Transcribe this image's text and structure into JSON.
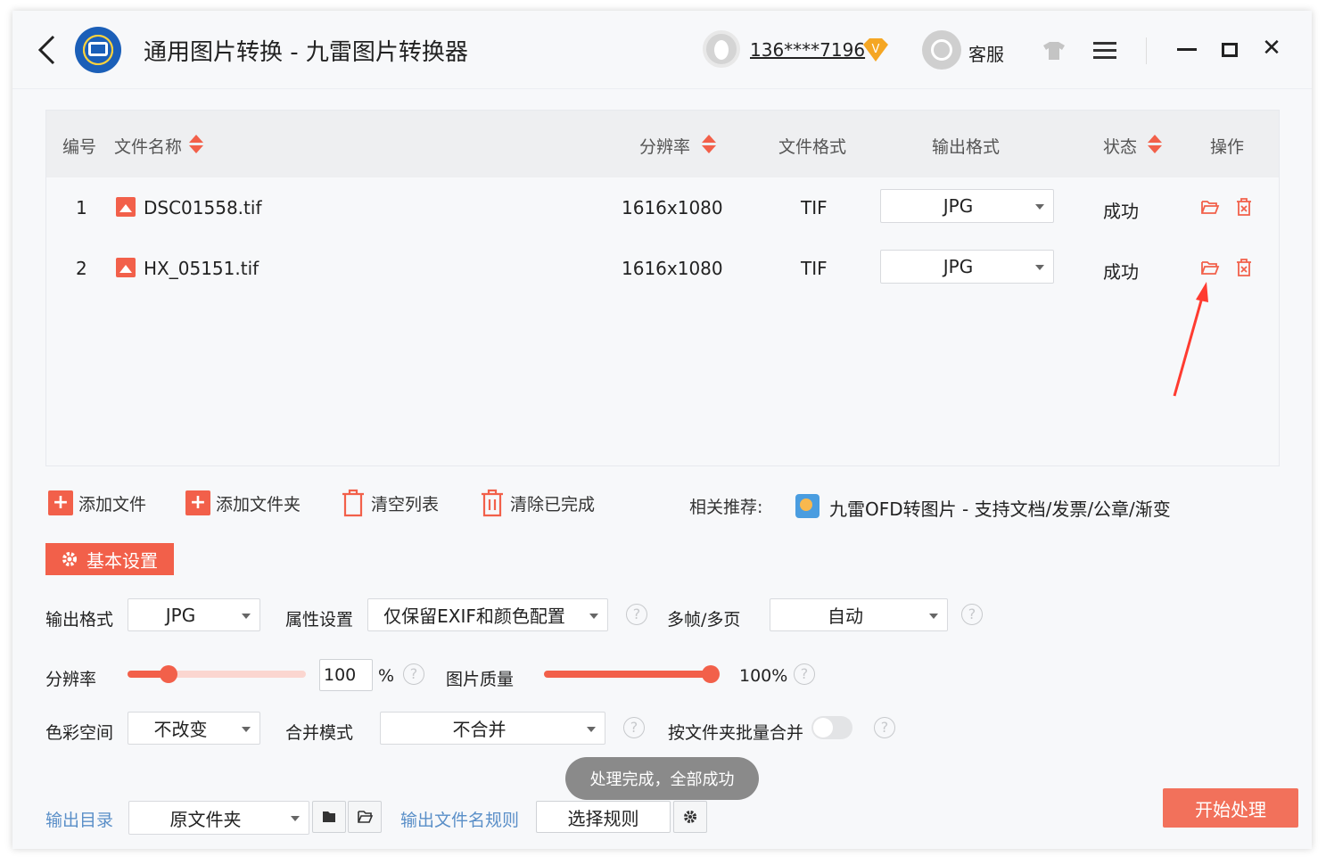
{
  "window": {
    "title": "通用图片转换 - 九雷图片转换器",
    "user_name": "136****7196",
    "vip_badge": "V",
    "service_label": "客服",
    "close_glyph": "✕"
  },
  "table": {
    "headers": {
      "index": "编号",
      "filename": "文件名称",
      "resolution": "分辨率",
      "file_format": "文件格式",
      "output_format": "输出格式",
      "status": "状态",
      "actions": "操作"
    },
    "rows": [
      {
        "index": "1",
        "filename": "DSC01558.tif",
        "resolution": "1616x1080",
        "file_format": "TIF",
        "output_format": "JPG",
        "status": "成功"
      },
      {
        "index": "2",
        "filename": "HX_05151.tif",
        "resolution": "1616x1080",
        "file_format": "TIF",
        "output_format": "JPG",
        "status": "成功"
      }
    ]
  },
  "toolbar": {
    "add_file": "添加文件",
    "add_folder": "添加文件夹",
    "clear_list": "清空列表",
    "clear_done": "清除已完成",
    "recommend_label": "相关推荐:",
    "recommend_link": "九雷OFD转图片 - 支持文档/发票/公章/渐变"
  },
  "settings": {
    "tab_label": "基本设置",
    "output_format_label": "输出格式",
    "output_format_value": "JPG",
    "attr_label": "属性设置",
    "attr_value": "仅保留EXIF和颜色配置",
    "multiframe_label": "多帧/多页",
    "multiframe_value": "自动",
    "resolution_label": "分辨率",
    "resolution_value": "100",
    "resolution_unit": "%",
    "quality_label": "图片质量",
    "quality_value": "100%",
    "colorspace_label": "色彩空间",
    "colorspace_value": "不改变",
    "merge_label": "合并模式",
    "merge_value": "不合并",
    "batch_merge_label": "按文件夹批量合并",
    "help_glyph": "?"
  },
  "output": {
    "dir_label": "输出目录",
    "dir_value": "原文件夹",
    "rule_label": "输出文件名规则",
    "rule_button": "选择规则",
    "start_button": "开始处理"
  },
  "toast": "处理完成，全部成功",
  "colors": {
    "accent": "#f2604a",
    "link_blue": "#5a8fc8"
  }
}
